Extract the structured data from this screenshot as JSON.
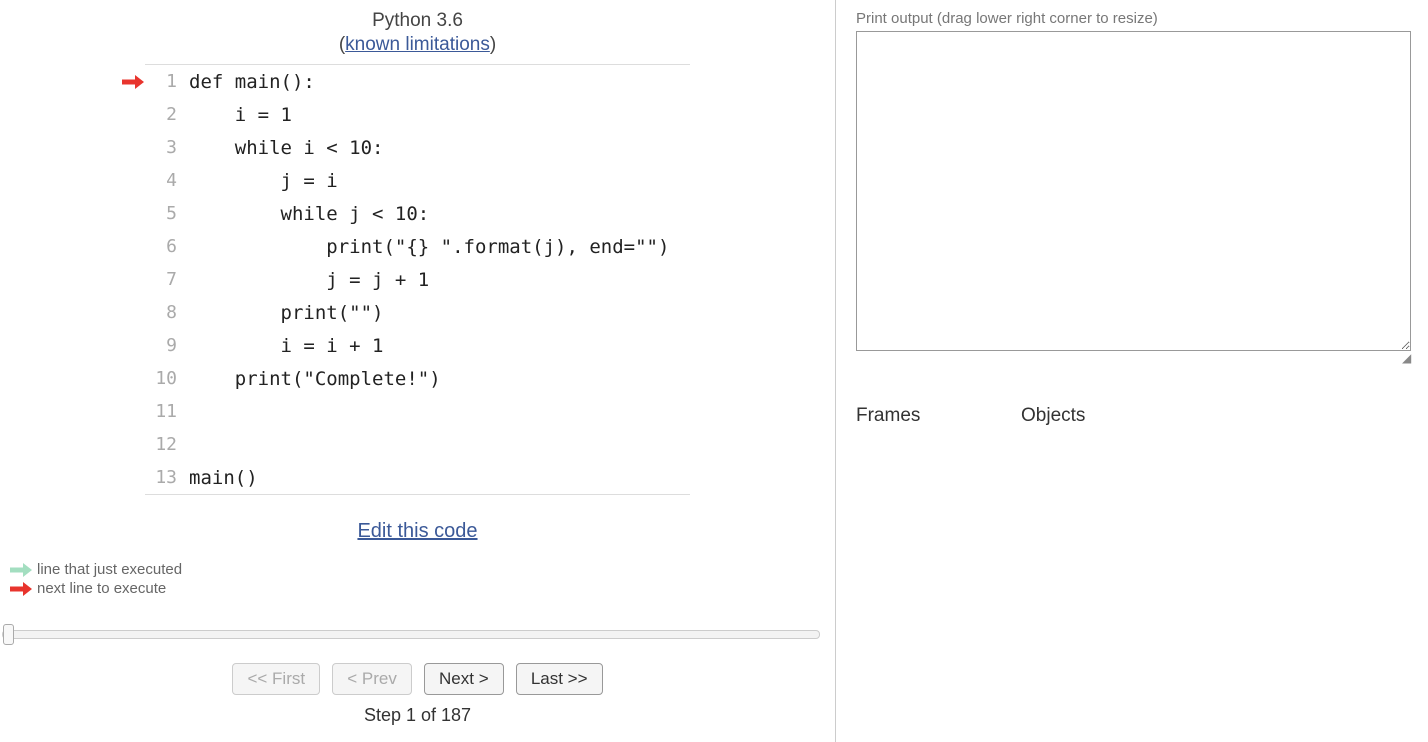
{
  "header": {
    "title": "Python 3.6",
    "paren_open": "(",
    "limitations_link": "known limitations",
    "paren_close": ")"
  },
  "code": {
    "current_line": 1,
    "lines": [
      {
        "n": "1",
        "text": "def main():"
      },
      {
        "n": "2",
        "text": "    i = 1"
      },
      {
        "n": "3",
        "text": "    while i < 10:"
      },
      {
        "n": "4",
        "text": "        j = i"
      },
      {
        "n": "5",
        "text": "        while j < 10:"
      },
      {
        "n": "6",
        "text": "            print(\"{} \".format(j), end=\"\")"
      },
      {
        "n": "7",
        "text": "            j = j + 1"
      },
      {
        "n": "8",
        "text": "        print(\"\")"
      },
      {
        "n": "9",
        "text": "        i = i + 1"
      },
      {
        "n": "10",
        "text": "    print(\"Complete!\")"
      },
      {
        "n": "11",
        "text": ""
      },
      {
        "n": "12",
        "text": ""
      },
      {
        "n": "13",
        "text": "main()"
      }
    ]
  },
  "links": {
    "edit_code": "Edit this code"
  },
  "legend": {
    "just_executed": "line that just executed",
    "next_line": "next line to execute"
  },
  "controls": {
    "first": "<< First",
    "prev": "< Prev",
    "next": "Next >",
    "last": "Last >>",
    "first_disabled": true,
    "prev_disabled": true,
    "next_disabled": false,
    "last_disabled": false,
    "slider_min": 1,
    "slider_max": 187,
    "slider_value": 1
  },
  "step": {
    "label": "Step 1 of 187"
  },
  "output": {
    "label": "Print output (drag lower right corner to resize)",
    "content": ""
  },
  "vis": {
    "frames_label": "Frames",
    "objects_label": "Objects"
  },
  "colors": {
    "next_arrow": "#e8342d",
    "prev_arrow": "#a3dec0"
  }
}
